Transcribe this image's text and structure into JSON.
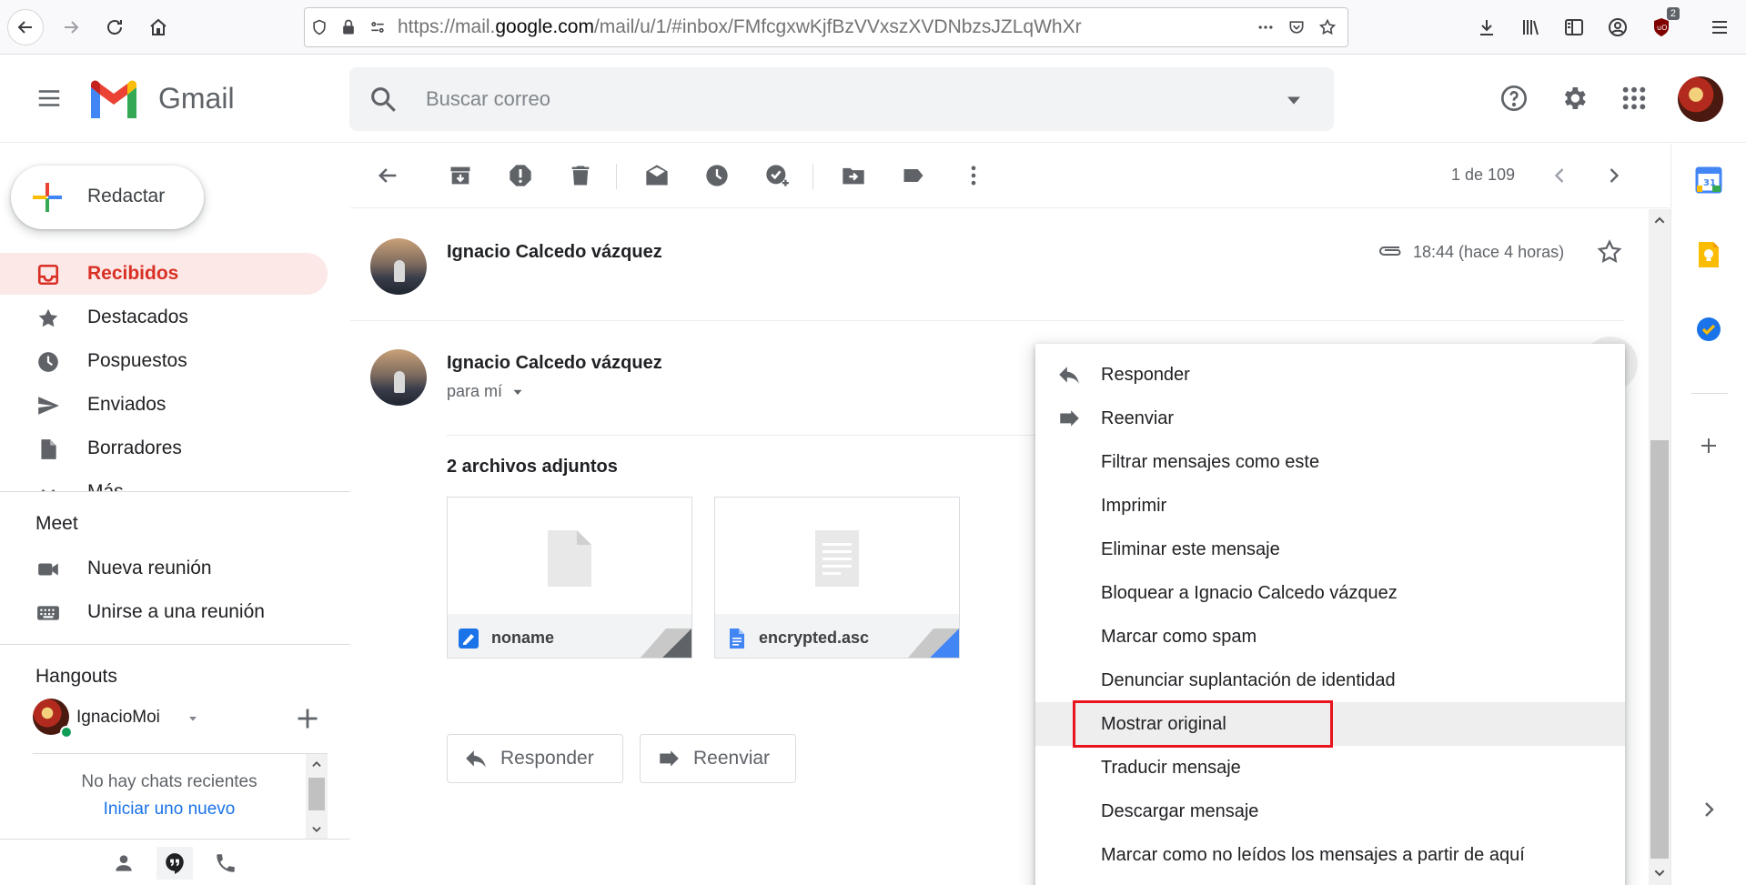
{
  "browser": {
    "url_prefix": "https://mail.",
    "url_host": "google.com",
    "url_path": "/mail/u/1/#inbox/FMfcgxwKjfBzVVxszXVDNbzsJZLqWhXr",
    "ublock_badge": "2"
  },
  "header": {
    "app_name": "Gmail",
    "search_placeholder": "Buscar correo"
  },
  "sidebar": {
    "compose_label": "Redactar",
    "items": [
      {
        "label": "Recibidos",
        "icon": "inbox-icon",
        "active": true
      },
      {
        "label": "Destacados",
        "icon": "star-icon"
      },
      {
        "label": "Pospuestos",
        "icon": "clock-icon"
      },
      {
        "label": "Enviados",
        "icon": "send-icon"
      },
      {
        "label": "Borradores",
        "icon": "draft-icon"
      },
      {
        "label": "Más",
        "icon": "chevron-down-icon"
      }
    ],
    "meet": {
      "title": "Meet",
      "new_meeting": "Nueva reunión",
      "join_meeting": "Unirse a una reunión"
    },
    "hangouts": {
      "title": "Hangouts",
      "user_name": "IgnacioMoi",
      "no_chats": "No hay chats recientes",
      "start_new": "Iniciar uno nuevo"
    }
  },
  "toolbar": {
    "pagination": "1 de 109"
  },
  "thread": {
    "messages": [
      {
        "sender": "Ignacio Calcedo vázquez",
        "time": "18:44 (hace 4 horas)"
      },
      {
        "sender": "Ignacio Calcedo vázquez",
        "recipient": "para mí"
      }
    ],
    "attachments_title": "2 archivos adjuntos",
    "attachments": [
      {
        "name": "noname",
        "type_color": "#1a73e8"
      },
      {
        "name": "encrypted.asc",
        "type_color": "#4285f4"
      }
    ],
    "reply_label": "Responder",
    "forward_label": "Reenviar"
  },
  "context_menu": {
    "items": [
      {
        "label": "Responder",
        "icon": "reply-icon"
      },
      {
        "label": "Reenviar",
        "icon": "forward-icon"
      },
      {
        "label": "Filtrar mensajes como este"
      },
      {
        "label": "Imprimir"
      },
      {
        "label": "Eliminar este mensaje"
      },
      {
        "label": "Bloquear a Ignacio Calcedo vázquez"
      },
      {
        "label": "Marcar como spam"
      },
      {
        "label": "Denunciar suplantación de identidad"
      },
      {
        "label": "Mostrar original",
        "highlighted": true
      },
      {
        "label": "Traducir mensaje"
      },
      {
        "label": "Descargar mensaje"
      },
      {
        "label": "Marcar como no leídos los mensajes a partir de aquí"
      }
    ]
  },
  "colors": {
    "accent_red": "#d93025",
    "highlight_box": "#e8141e",
    "link_blue": "#1a73e8"
  }
}
